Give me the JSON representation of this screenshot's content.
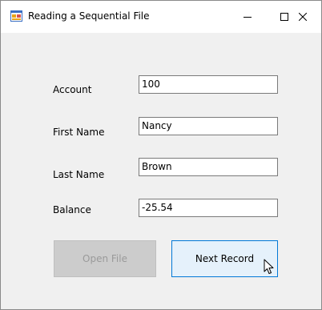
{
  "window": {
    "title": "Reading a Sequential File",
    "app_icon": "winforms-app-icon",
    "controls": {
      "minimize": "minimize-icon",
      "maximize": "maximize-icon",
      "close": "close-icon"
    }
  },
  "form": {
    "fields": [
      {
        "label": "Account",
        "value": "100"
      },
      {
        "label": "First Name",
        "value": "Nancy"
      },
      {
        "label": "Last Name",
        "value": "Brown"
      },
      {
        "label": "Balance",
        "value": "-25.54"
      }
    ],
    "buttons": {
      "open_file": {
        "label": "Open File",
        "enabled": false
      },
      "next_record": {
        "label": "Next Record",
        "enabled": true,
        "hovered": true
      }
    }
  },
  "colors": {
    "client_bg": "#f0f0f0",
    "button_hover_border": "#0078d7",
    "button_hover_bg": "#e5f1fb",
    "disabled_button_bg": "#cccccc",
    "disabled_text": "#9a9a9a"
  },
  "cursor": "mouse-pointer-icon"
}
